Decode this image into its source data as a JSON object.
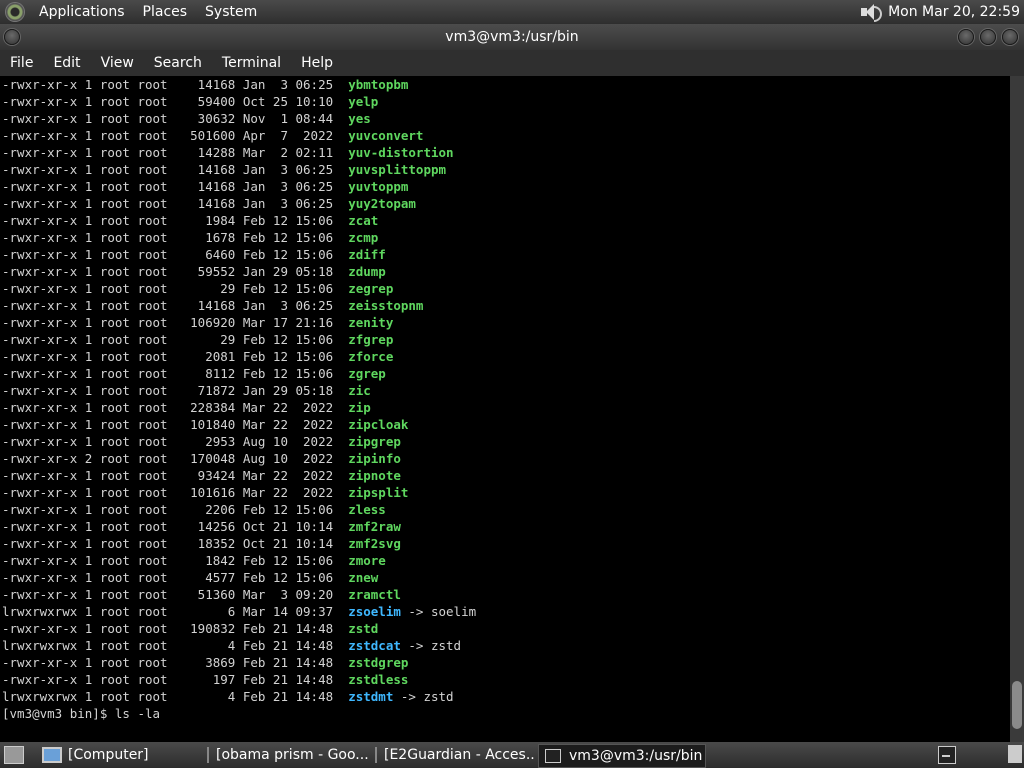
{
  "top_panel": {
    "menus": [
      "Applications",
      "Places",
      "System"
    ],
    "clock": "Mon Mar 20, 22:59"
  },
  "window": {
    "title": "vm3@vm3:/usr/bin"
  },
  "menubar": [
    "File",
    "Edit",
    "View",
    "Search",
    "Terminal",
    "Help"
  ],
  "terminal": {
    "colors": {
      "file": "#5fd75f",
      "symlink": "#3fb8ff",
      "text": "#d3d3d3"
    },
    "listing": [
      {
        "perm": "-rwxr-xr-x",
        "links": "1",
        "owner": "root",
        "group": "root",
        "size": "14168",
        "date": "Jan  3 06:25",
        "name": "ybmtopbm",
        "kind": "file",
        "target": ""
      },
      {
        "perm": "-rwxr-xr-x",
        "links": "1",
        "owner": "root",
        "group": "root",
        "size": "59400",
        "date": "Oct 25 10:10",
        "name": "yelp",
        "kind": "file",
        "target": ""
      },
      {
        "perm": "-rwxr-xr-x",
        "links": "1",
        "owner": "root",
        "group": "root",
        "size": "30632",
        "date": "Nov  1 08:44",
        "name": "yes",
        "kind": "file",
        "target": ""
      },
      {
        "perm": "-rwxr-xr-x",
        "links": "1",
        "owner": "root",
        "group": "root",
        "size": "501600",
        "date": "Apr  7  2022",
        "name": "yuvconvert",
        "kind": "file",
        "target": ""
      },
      {
        "perm": "-rwxr-xr-x",
        "links": "1",
        "owner": "root",
        "group": "root",
        "size": "14288",
        "date": "Mar  2 02:11",
        "name": "yuv-distortion",
        "kind": "file",
        "target": ""
      },
      {
        "perm": "-rwxr-xr-x",
        "links": "1",
        "owner": "root",
        "group": "root",
        "size": "14168",
        "date": "Jan  3 06:25",
        "name": "yuvsplittoppm",
        "kind": "file",
        "target": ""
      },
      {
        "perm": "-rwxr-xr-x",
        "links": "1",
        "owner": "root",
        "group": "root",
        "size": "14168",
        "date": "Jan  3 06:25",
        "name": "yuvtoppm",
        "kind": "file",
        "target": ""
      },
      {
        "perm": "-rwxr-xr-x",
        "links": "1",
        "owner": "root",
        "group": "root",
        "size": "14168",
        "date": "Jan  3 06:25",
        "name": "yuy2topam",
        "kind": "file",
        "target": ""
      },
      {
        "perm": "-rwxr-xr-x",
        "links": "1",
        "owner": "root",
        "group": "root",
        "size": "1984",
        "date": "Feb 12 15:06",
        "name": "zcat",
        "kind": "file",
        "target": ""
      },
      {
        "perm": "-rwxr-xr-x",
        "links": "1",
        "owner": "root",
        "group": "root",
        "size": "1678",
        "date": "Feb 12 15:06",
        "name": "zcmp",
        "kind": "file",
        "target": ""
      },
      {
        "perm": "-rwxr-xr-x",
        "links": "1",
        "owner": "root",
        "group": "root",
        "size": "6460",
        "date": "Feb 12 15:06",
        "name": "zdiff",
        "kind": "file",
        "target": ""
      },
      {
        "perm": "-rwxr-xr-x",
        "links": "1",
        "owner": "root",
        "group": "root",
        "size": "59552",
        "date": "Jan 29 05:18",
        "name": "zdump",
        "kind": "file",
        "target": ""
      },
      {
        "perm": "-rwxr-xr-x",
        "links": "1",
        "owner": "root",
        "group": "root",
        "size": "29",
        "date": "Feb 12 15:06",
        "name": "zegrep",
        "kind": "file",
        "target": ""
      },
      {
        "perm": "-rwxr-xr-x",
        "links": "1",
        "owner": "root",
        "group": "root",
        "size": "14168",
        "date": "Jan  3 06:25",
        "name": "zeisstopnm",
        "kind": "file",
        "target": ""
      },
      {
        "perm": "-rwxr-xr-x",
        "links": "1",
        "owner": "root",
        "group": "root",
        "size": "106920",
        "date": "Mar 17 21:16",
        "name": "zenity",
        "kind": "file",
        "target": ""
      },
      {
        "perm": "-rwxr-xr-x",
        "links": "1",
        "owner": "root",
        "group": "root",
        "size": "29",
        "date": "Feb 12 15:06",
        "name": "zfgrep",
        "kind": "file",
        "target": ""
      },
      {
        "perm": "-rwxr-xr-x",
        "links": "1",
        "owner": "root",
        "group": "root",
        "size": "2081",
        "date": "Feb 12 15:06",
        "name": "zforce",
        "kind": "file",
        "target": ""
      },
      {
        "perm": "-rwxr-xr-x",
        "links": "1",
        "owner": "root",
        "group": "root",
        "size": "8112",
        "date": "Feb 12 15:06",
        "name": "zgrep",
        "kind": "file",
        "target": ""
      },
      {
        "perm": "-rwxr-xr-x",
        "links": "1",
        "owner": "root",
        "group": "root",
        "size": "71872",
        "date": "Jan 29 05:18",
        "name": "zic",
        "kind": "file",
        "target": ""
      },
      {
        "perm": "-rwxr-xr-x",
        "links": "1",
        "owner": "root",
        "group": "root",
        "size": "228384",
        "date": "Mar 22  2022",
        "name": "zip",
        "kind": "file",
        "target": ""
      },
      {
        "perm": "-rwxr-xr-x",
        "links": "1",
        "owner": "root",
        "group": "root",
        "size": "101840",
        "date": "Mar 22  2022",
        "name": "zipcloak",
        "kind": "file",
        "target": ""
      },
      {
        "perm": "-rwxr-xr-x",
        "links": "1",
        "owner": "root",
        "group": "root",
        "size": "2953",
        "date": "Aug 10  2022",
        "name": "zipgrep",
        "kind": "file",
        "target": ""
      },
      {
        "perm": "-rwxr-xr-x",
        "links": "2",
        "owner": "root",
        "group": "root",
        "size": "170048",
        "date": "Aug 10  2022",
        "name": "zipinfo",
        "kind": "file",
        "target": ""
      },
      {
        "perm": "-rwxr-xr-x",
        "links": "1",
        "owner": "root",
        "group": "root",
        "size": "93424",
        "date": "Mar 22  2022",
        "name": "zipnote",
        "kind": "file",
        "target": ""
      },
      {
        "perm": "-rwxr-xr-x",
        "links": "1",
        "owner": "root",
        "group": "root",
        "size": "101616",
        "date": "Mar 22  2022",
        "name": "zipsplit",
        "kind": "file",
        "target": ""
      },
      {
        "perm": "-rwxr-xr-x",
        "links": "1",
        "owner": "root",
        "group": "root",
        "size": "2206",
        "date": "Feb 12 15:06",
        "name": "zless",
        "kind": "file",
        "target": ""
      },
      {
        "perm": "-rwxr-xr-x",
        "links": "1",
        "owner": "root",
        "group": "root",
        "size": "14256",
        "date": "Oct 21 10:14",
        "name": "zmf2raw",
        "kind": "file",
        "target": ""
      },
      {
        "perm": "-rwxr-xr-x",
        "links": "1",
        "owner": "root",
        "group": "root",
        "size": "18352",
        "date": "Oct 21 10:14",
        "name": "zmf2svg",
        "kind": "file",
        "target": ""
      },
      {
        "perm": "-rwxr-xr-x",
        "links": "1",
        "owner": "root",
        "group": "root",
        "size": "1842",
        "date": "Feb 12 15:06",
        "name": "zmore",
        "kind": "file",
        "target": ""
      },
      {
        "perm": "-rwxr-xr-x",
        "links": "1",
        "owner": "root",
        "group": "root",
        "size": "4577",
        "date": "Feb 12 15:06",
        "name": "znew",
        "kind": "file",
        "target": ""
      },
      {
        "perm": "-rwxr-xr-x",
        "links": "1",
        "owner": "root",
        "group": "root",
        "size": "51360",
        "date": "Mar  3 09:20",
        "name": "zramctl",
        "kind": "file",
        "target": ""
      },
      {
        "perm": "lrwxrwxrwx",
        "links": "1",
        "owner": "root",
        "group": "root",
        "size": "6",
        "date": "Mar 14 09:37",
        "name": "zsoelim",
        "kind": "symlink",
        "target": "soelim"
      },
      {
        "perm": "-rwxr-xr-x",
        "links": "1",
        "owner": "root",
        "group": "root",
        "size": "190832",
        "date": "Feb 21 14:48",
        "name": "zstd",
        "kind": "file",
        "target": ""
      },
      {
        "perm": "lrwxrwxrwx",
        "links": "1",
        "owner": "root",
        "group": "root",
        "size": "4",
        "date": "Feb 21 14:48",
        "name": "zstdcat",
        "kind": "symlink",
        "target": "zstd"
      },
      {
        "perm": "-rwxr-xr-x",
        "links": "1",
        "owner": "root",
        "group": "root",
        "size": "3869",
        "date": "Feb 21 14:48",
        "name": "zstdgrep",
        "kind": "file",
        "target": ""
      },
      {
        "perm": "-rwxr-xr-x",
        "links": "1",
        "owner": "root",
        "group": "root",
        "size": "197",
        "date": "Feb 21 14:48",
        "name": "zstdless",
        "kind": "file",
        "target": ""
      },
      {
        "perm": "lrwxrwxrwx",
        "links": "1",
        "owner": "root",
        "group": "root",
        "size": "4",
        "date": "Feb 21 14:48",
        "name": "zstdmt",
        "kind": "symlink",
        "target": "zstd"
      }
    ],
    "prompt": "[vm3@vm3 bin]$ ls -la"
  },
  "taskbar": {
    "tasks": [
      {
        "label": "[Computer]",
        "icon": "computer-icon",
        "active": false
      },
      {
        "label": "[obama prism - Goo...",
        "icon": "chrome-icon",
        "active": false
      },
      {
        "label": "[E2Guardian - Acces...",
        "icon": "chrome-icon",
        "active": false
      },
      {
        "label": "vm3@vm3:/usr/bin",
        "icon": "terminal-icon",
        "active": true
      }
    ]
  }
}
